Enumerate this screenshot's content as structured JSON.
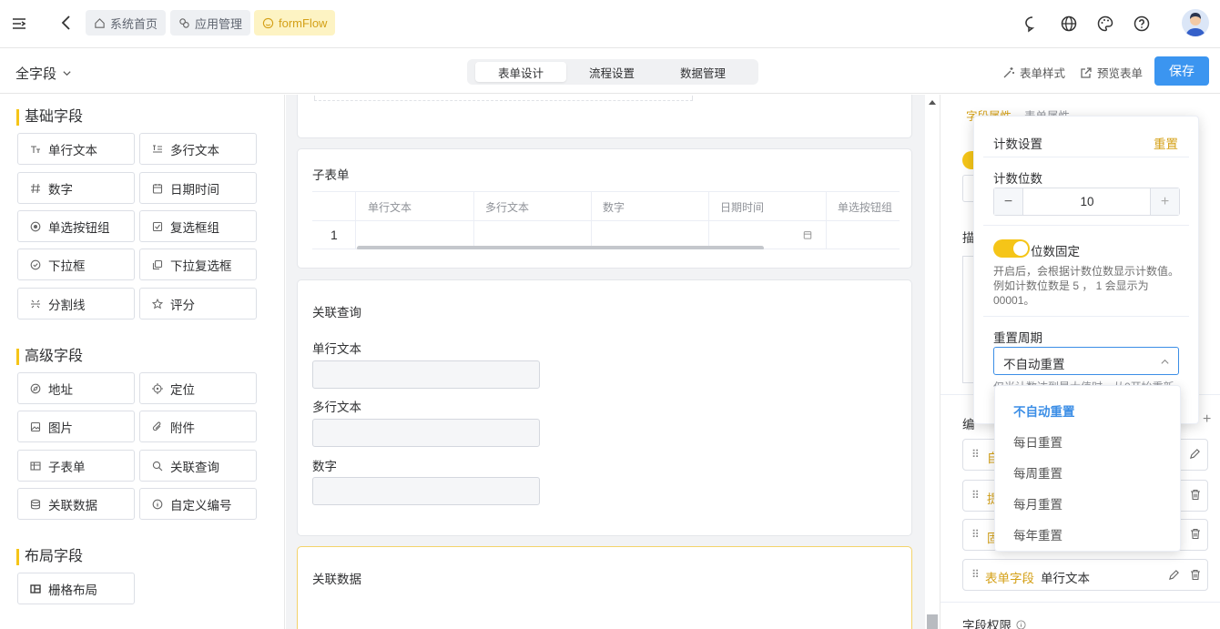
{
  "header": {
    "breadcrumbs": [
      {
        "label": "系统首页",
        "icon": "home-icon"
      },
      {
        "label": "应用管理",
        "icon": "apps-icon"
      },
      {
        "label": "formFlow",
        "icon": "smile-icon"
      }
    ]
  },
  "subbar": {
    "scope_label": "全字段",
    "tabs": [
      {
        "label": "表单设计"
      },
      {
        "label": "流程设置"
      },
      {
        "label": "数据管理"
      }
    ],
    "active_tab": "表单设计",
    "form_style_label": "表单样式",
    "preview_label": "预览表单",
    "save_label": "保存"
  },
  "left": {
    "basic_title": "基础字段",
    "basic": [
      "单行文本",
      "多行文本",
      "数字",
      "日期时间",
      "单选按钮组",
      "复选框组",
      "下拉框",
      "下拉复选框",
      "分割线",
      "评分"
    ],
    "advanced_title": "高级字段",
    "advanced": [
      "地址",
      "定位",
      "图片",
      "附件",
      "子表单",
      "关联查询",
      "关联数据",
      "自定义编号"
    ],
    "layout_title": "布局字段",
    "layout": [
      "栅格布局"
    ]
  },
  "canvas": {
    "subform": {
      "title": "子表单",
      "columns": [
        "单行文本",
        "多行文本",
        "数字",
        "日期时间",
        "单选按钮组"
      ],
      "row_index": "1"
    },
    "query": {
      "title": "关联查询",
      "fields": [
        "单行文本",
        "多行文本",
        "数字"
      ]
    },
    "data": {
      "title": "关联数据"
    }
  },
  "right": {
    "tab_field": "字段属性",
    "tab_form": "表单属性",
    "desc_label": "描",
    "edit_label": "编",
    "rows": [
      {
        "prefix": "自",
        "name": ""
      },
      {
        "prefix": "提",
        "name": ""
      },
      {
        "prefix": "固",
        "name": ""
      },
      {
        "prefix": "表单字段",
        "name": "单行文本"
      }
    ],
    "permission_label": "字段权限"
  },
  "popover": {
    "title": "计数设置",
    "reset_label": "重置",
    "digits_label": "计数位数",
    "digits_value": "10",
    "fixed_label": "位数固定",
    "fixed_on": true,
    "help": "开启后，会根据计数位数显示计数值。例如计数位数是 5 ， 1 会显示为 00001。",
    "period_label": "重置周期",
    "period_value": "不自动重置",
    "period_help": "仅当计数达到最大值时，从0开始重新"
  },
  "dropdown": {
    "options": [
      "不自动重置",
      "每日重置",
      "每周重置",
      "每月重置",
      "每年重置"
    ],
    "selected": "不自动重置"
  },
  "colors": {
    "accent": "#f5c518",
    "primary": "#3b95f0",
    "link": "#3b8ee6",
    "gold_text": "#d4a017"
  }
}
